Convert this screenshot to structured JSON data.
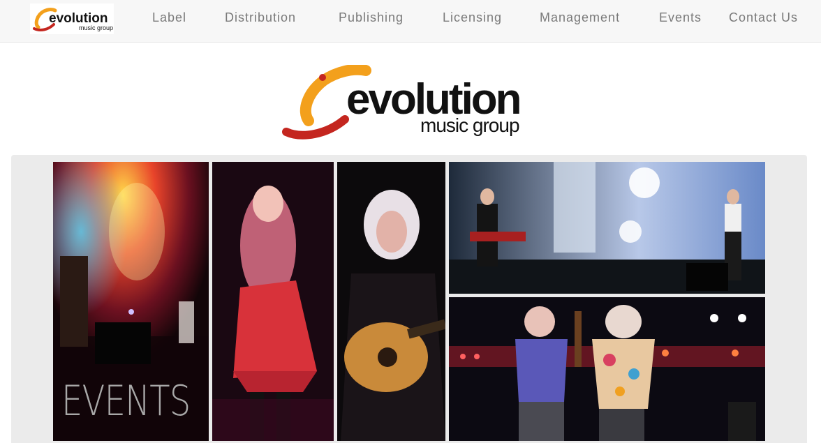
{
  "nav": {
    "logo_text": "evolution",
    "logo_subtext": "music group",
    "items": [
      {
        "label": "Label"
      },
      {
        "label": "Distribution"
      },
      {
        "label": "Publishing"
      },
      {
        "label": "Licensing"
      },
      {
        "label": "Management"
      },
      {
        "label": "Events"
      },
      {
        "label": "Contact Us"
      }
    ]
  },
  "brand": {
    "name": "evolution",
    "subtitle": "music group",
    "colors": {
      "orange": "#f3a01c",
      "red": "#c4261f",
      "text": "#111111"
    }
  },
  "gallery": {
    "caption": "EVENTS",
    "panels": [
      {
        "name": "concert-stage-photo"
      },
      {
        "name": "singer-red-dress-photo"
      },
      {
        "name": "guitarist-white-hair-photo"
      },
      {
        "name": "band-stage-lights-photo"
      },
      {
        "name": "duo-guitar-stage-photo"
      }
    ]
  }
}
